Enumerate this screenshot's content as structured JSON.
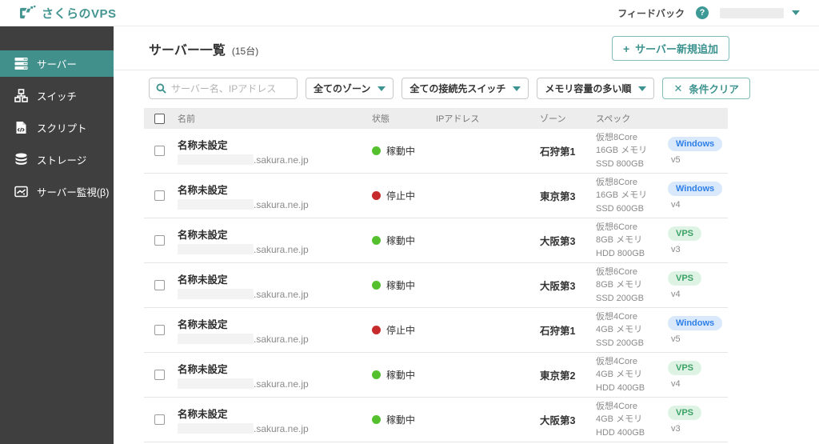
{
  "accent": "#3d938f",
  "topbar": {
    "logo_text": "さくらのVPS",
    "feedback_label": "フィードバック",
    "help_glyph": "?"
  },
  "sidebar": {
    "items": [
      {
        "label": "サーバー",
        "icon": "server-icon",
        "active": true
      },
      {
        "label": "スイッチ",
        "icon": "switch-icon",
        "active": false
      },
      {
        "label": "スクリプト",
        "icon": "script-icon",
        "active": false
      },
      {
        "label": "ストレージ",
        "icon": "storage-icon",
        "active": false
      },
      {
        "label": "サーバー監視(β)",
        "icon": "monitor-icon",
        "active": false
      }
    ]
  },
  "main": {
    "title": "サーバー一覧",
    "count": "(15台)",
    "add_button": "サーバー新規追加",
    "add_plus": "+",
    "filters": {
      "search_placeholder": "サーバー名、IPアドレス",
      "zone_select": "全てのゾーン",
      "switch_select": "全ての接続先スイッチ",
      "sort_select": "メモリ容量の多い順",
      "clear_button": "条件クリア",
      "clear_x": "✕"
    },
    "table": {
      "columns": {
        "name": "名前",
        "status": "状態",
        "ip": "IPアドレス",
        "zone": "ゾーン",
        "spec": "スペック"
      },
      "domain_suffix": ".sakura.ne.jp",
      "rows": [
        {
          "name": "名称未設定",
          "domain": ".sakura.ne.jp",
          "status": "稼動中",
          "status_color": "green",
          "zone": "石狩第1",
          "spec1": "仮想8Core",
          "spec2": "16GB メモリ",
          "spec3": "SSD 800GB",
          "badge": "Windows",
          "badge_type": "windows",
          "version": "v5"
        },
        {
          "name": "名称未設定",
          "domain": ".sakura.ne.jp",
          "status": "停止中",
          "status_color": "red",
          "zone": "東京第3",
          "spec1": "仮想8Core",
          "spec2": "16GB メモリ",
          "spec3": "SSD 600GB",
          "badge": "Windows",
          "badge_type": "windows",
          "version": "v4"
        },
        {
          "name": "名称未設定",
          "domain": ".sakura.ne.jp",
          "status": "稼動中",
          "status_color": "green",
          "zone": "大阪第3",
          "spec1": "仮想6Core",
          "spec2": "8GB メモリ",
          "spec3": "HDD 800GB",
          "badge": "VPS",
          "badge_type": "vps",
          "version": "v3"
        },
        {
          "name": "名称未設定",
          "domain": ".sakura.ne.jp",
          "status": "稼動中",
          "status_color": "green",
          "zone": "大阪第3",
          "spec1": "仮想6Core",
          "spec2": "8GB メモリ",
          "spec3": "SSD 200GB",
          "badge": "VPS",
          "badge_type": "vps",
          "version": "v4"
        },
        {
          "name": "名称未設定",
          "domain": ".sakura.ne.jp",
          "status": "停止中",
          "status_color": "red",
          "zone": "石狩第1",
          "spec1": "仮想4Core",
          "spec2": "4GB メモリ",
          "spec3": "SSD 200GB",
          "badge": "Windows",
          "badge_type": "windows",
          "version": "v5"
        },
        {
          "name": "名称未設定",
          "domain": ".sakura.ne.jp",
          "status": "稼動中",
          "status_color": "green",
          "zone": "東京第2",
          "spec1": "仮想4Core",
          "spec2": "4GB メモリ",
          "spec3": "HDD 400GB",
          "badge": "VPS",
          "badge_type": "vps",
          "version": "v4"
        },
        {
          "name": "名称未設定",
          "domain": ".sakura.ne.jp",
          "status": "稼動中",
          "status_color": "green",
          "zone": "大阪第3",
          "spec1": "仮想4Core",
          "spec2": "4GB メモリ",
          "spec3": "HDD 400GB",
          "badge": "VPS",
          "badge_type": "vps",
          "version": "v3"
        }
      ]
    }
  }
}
